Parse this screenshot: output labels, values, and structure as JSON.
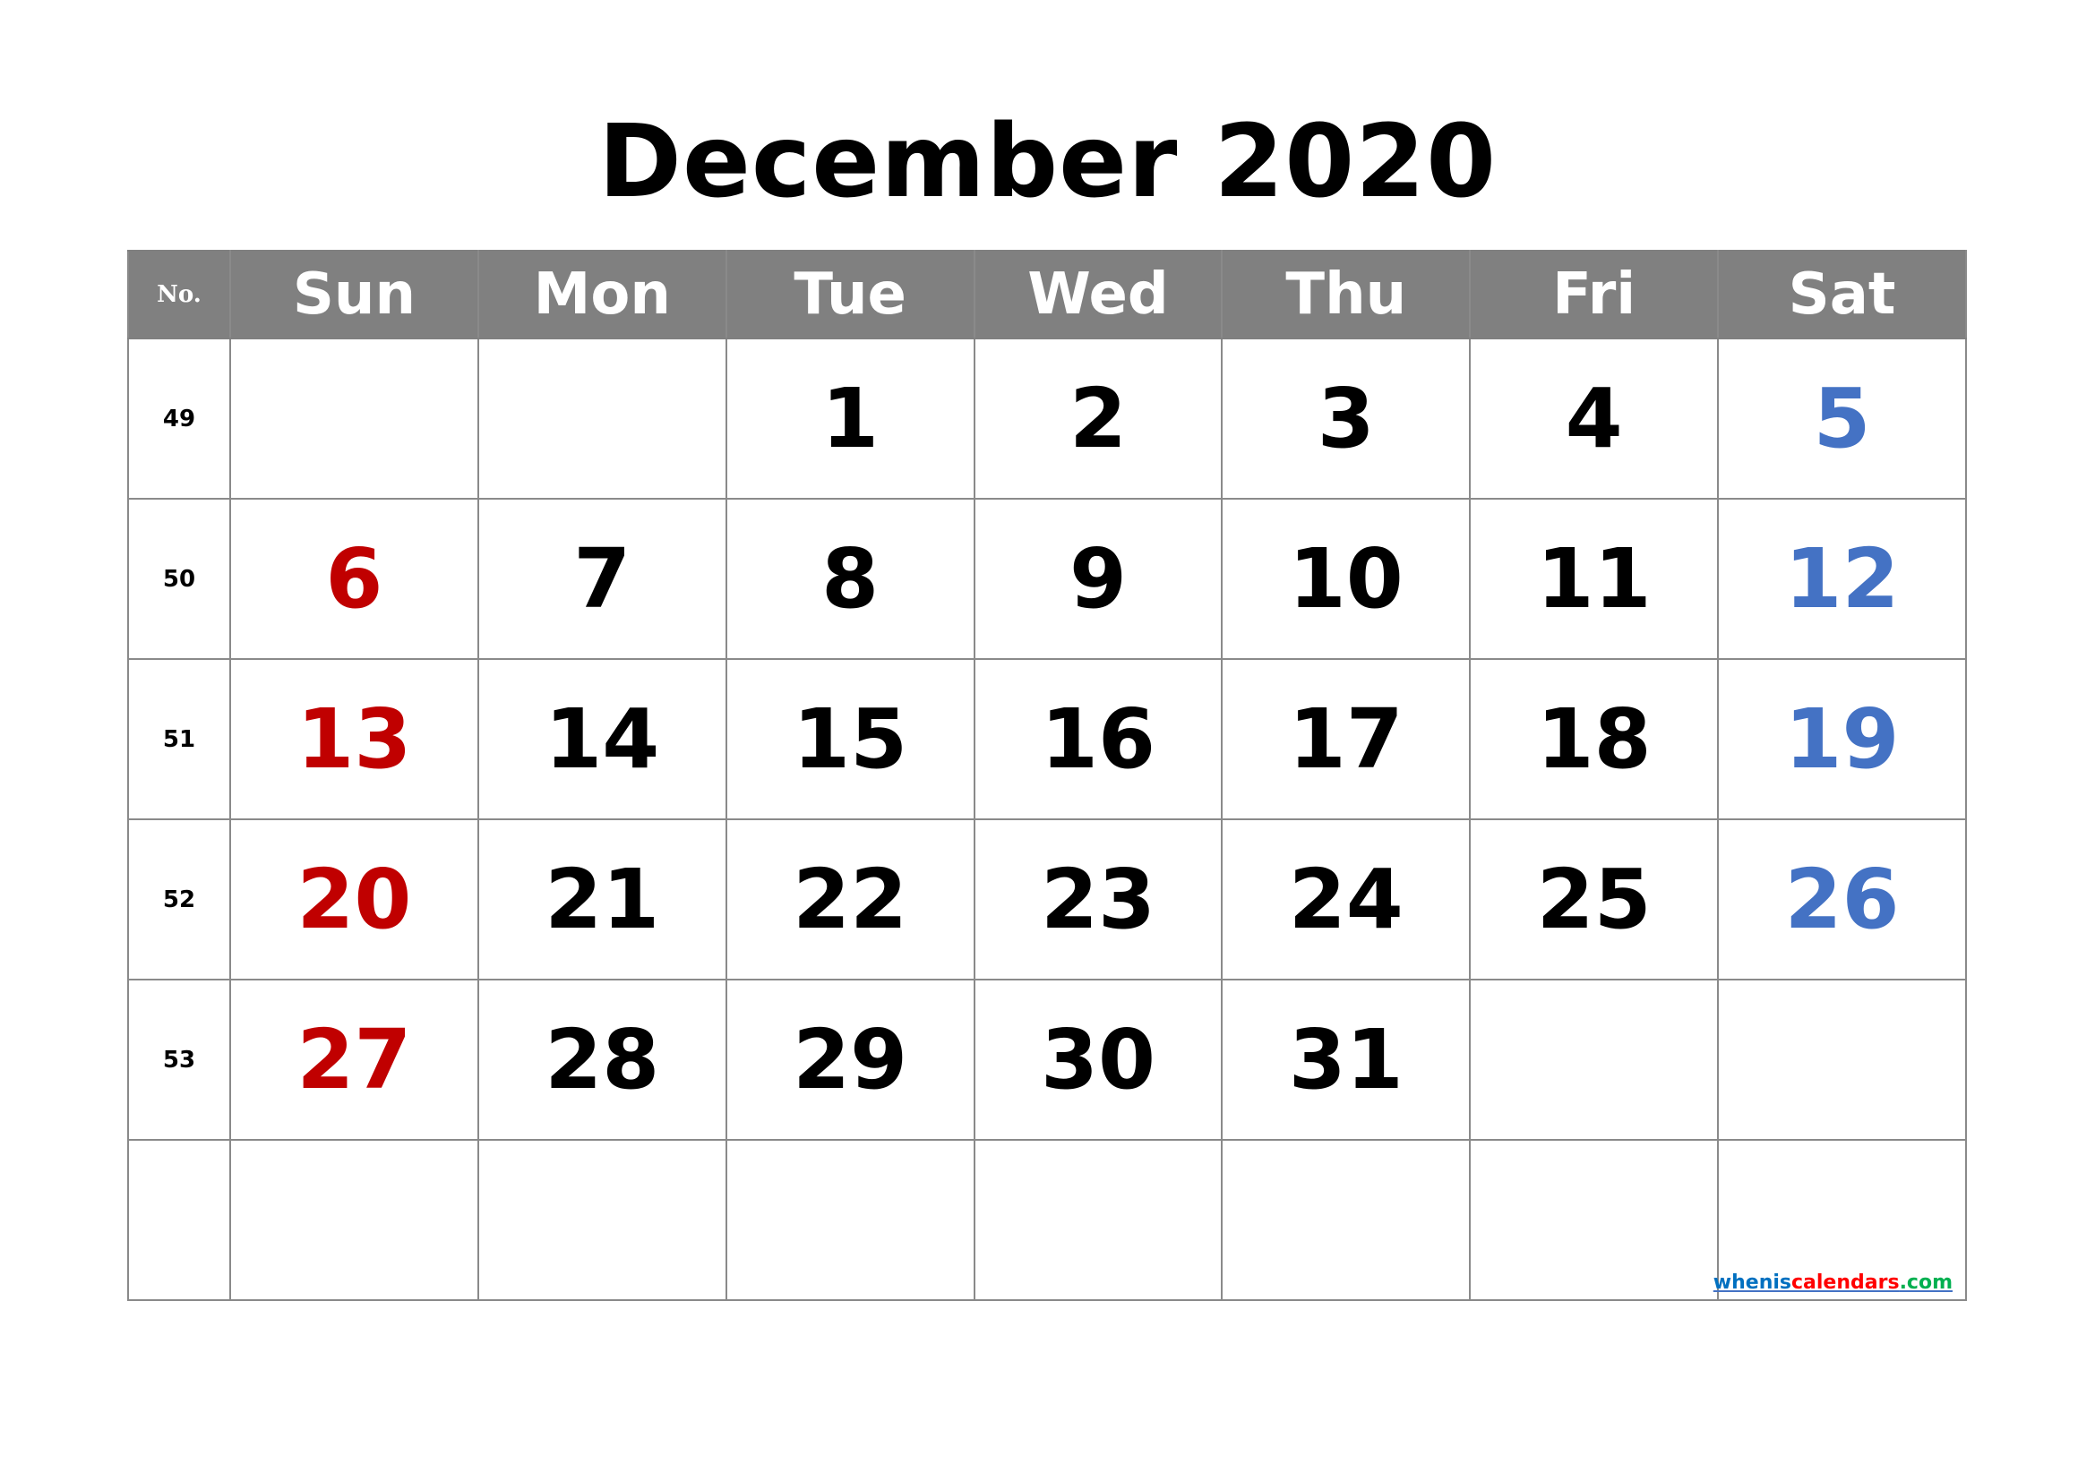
{
  "title": "December 2020",
  "header": {
    "week_no_label": "No.",
    "days": [
      "Sun",
      "Mon",
      "Tue",
      "Wed",
      "Thu",
      "Fri",
      "Sat"
    ]
  },
  "colors": {
    "header_bg": "#808080",
    "header_text": "#FFFFFF",
    "sunday": "#C00000",
    "saturday": "#4472C4",
    "weekday": "#000000",
    "grid_line": "#8A8A8A"
  },
  "weeks": [
    {
      "no": "49",
      "days": [
        "",
        "",
        "1",
        "2",
        "3",
        "4",
        "5"
      ]
    },
    {
      "no": "50",
      "days": [
        "6",
        "7",
        "8",
        "9",
        "10",
        "11",
        "12"
      ]
    },
    {
      "no": "51",
      "days": [
        "13",
        "14",
        "15",
        "16",
        "17",
        "18",
        "19"
      ]
    },
    {
      "no": "52",
      "days": [
        "20",
        "21",
        "22",
        "23",
        "24",
        "25",
        "26"
      ]
    },
    {
      "no": "53",
      "days": [
        "27",
        "28",
        "29",
        "30",
        "31",
        "",
        ""
      ]
    },
    {
      "no": "",
      "days": [
        "",
        "",
        "",
        "",
        "",
        "",
        ""
      ]
    }
  ],
  "watermark": {
    "part1": "whenis",
    "part2": "calendars",
    "part3": ".com",
    "colors": [
      "#0070C0",
      "#FF0000",
      "#00B050"
    ]
  }
}
